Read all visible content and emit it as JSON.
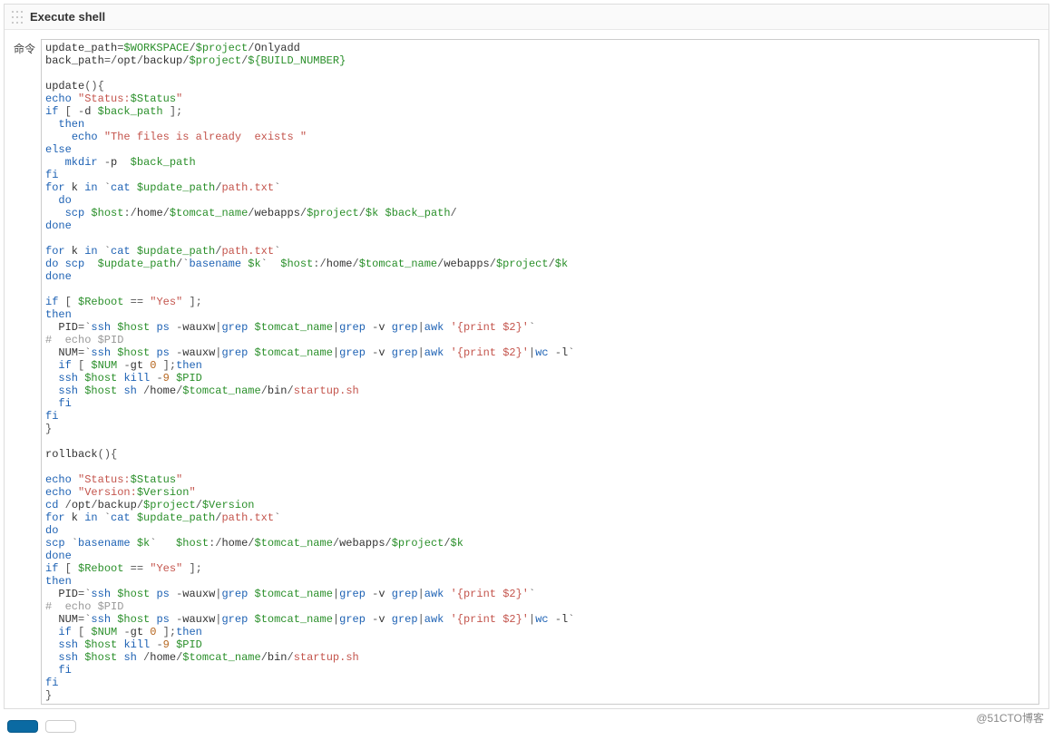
{
  "step": {
    "title": "Execute shell",
    "field_label": "命令",
    "script_lines": [
      "update_path=$WORKSPACE/$project/Onlyadd",
      "back_path=/opt/backup/$project/${BUILD_NUMBER}",
      "",
      "update(){",
      "echo \"Status:$Status\"",
      "if [ -d $back_path ];",
      "  then",
      "    echo \"The files is already  exists \"",
      "else",
      "   mkdir -p  $back_path",
      "fi",
      "for k in `cat $update_path/path.txt`",
      "  do",
      "   scp $host:/home/$tomcat_name/webapps/$project/$k $back_path/",
      "done",
      "",
      "for k in `cat $update_path/path.txt`",
      "do scp  $update_path/`basename $k`  $host:/home/$tomcat_name/webapps/$project/$k",
      "done",
      "",
      "if [ $Reboot == \"Yes\" ];",
      "then",
      "  PID=`ssh $host ps -wauxw|grep $tomcat_name|grep -v grep|awk '{print $2}'`",
      "#  echo $PID",
      "  NUM=`ssh $host ps -wauxw|grep $tomcat_name|grep -v grep|awk '{print $2}'|wc -l`",
      "  if [ $NUM -gt 0 ];then",
      "  ssh $host kill -9 $PID",
      "  ssh $host sh /home/$tomcat_name/bin/startup.sh",
      "  fi",
      "fi",
      "}",
      "",
      "rollback(){",
      "",
      "echo \"Status:$Status\"",
      "echo \"Version:$Version\"",
      "cd /opt/backup/$project/$Version",
      "for k in `cat $update_path/path.txt`",
      "do",
      "scp `basename $k`   $host:/home/$tomcat_name/webapps/$project/$k",
      "done",
      "if [ $Reboot == \"Yes\" ];",
      "then",
      "  PID=`ssh $host ps -wauxw|grep $tomcat_name|grep -v grep|awk '{print $2}'`",
      "#  echo $PID",
      "  NUM=`ssh $host ps -wauxw|grep $tomcat_name|grep -v grep|awk '{print $2}'|wc -l`",
      "  if [ $NUM -gt 0 ];then",
      "  ssh $host kill -9 $PID",
      "  ssh $host sh /home/$tomcat_name/bin/startup.sh",
      "  fi",
      "fi",
      "}"
    ]
  },
  "buttons": {
    "save": "",
    "apply": ""
  },
  "watermark": "@51CTO博客"
}
